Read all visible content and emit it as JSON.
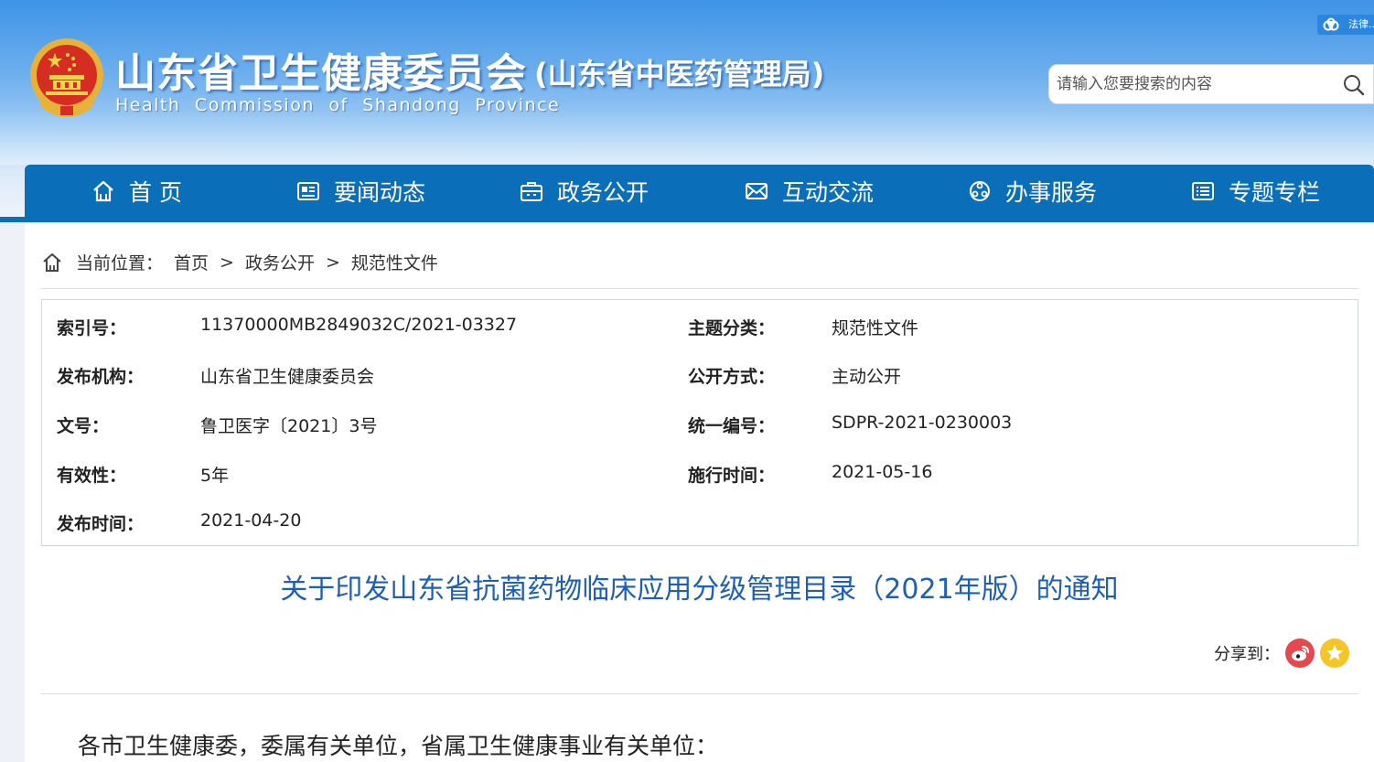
{
  "header": {
    "title": "山东省卫生健康委员会",
    "subtitle": "(山东省中医药管理局)",
    "english_name": "Health Commission of Shandong Province",
    "badge_label": "法律...",
    "search": {
      "placeholder": "请输入您要搜索的内容",
      "value": ""
    }
  },
  "nav": {
    "items": [
      {
        "label": "首 页",
        "icon": "home-icon"
      },
      {
        "label": "要闻动态",
        "icon": "news-icon"
      },
      {
        "label": "政务公开",
        "icon": "briefcase-icon"
      },
      {
        "label": "互动交流",
        "icon": "envelope-icon"
      },
      {
        "label": "办事服务",
        "icon": "service-icon"
      },
      {
        "label": "专题专栏",
        "icon": "column-icon"
      }
    ]
  },
  "breadcrumb": {
    "prefix": "当前位置：",
    "items": [
      "首页",
      "政务公开",
      "规范性文件"
    ],
    "separator": ">"
  },
  "meta": {
    "index_no": {
      "key": "索引号：",
      "value": "11370000MB2849032C/2021-03327"
    },
    "topic": {
      "key": "主题分类：",
      "value": "规范性文件"
    },
    "publisher": {
      "key": "发布机构：",
      "value": "山东省卫生健康委员会"
    },
    "disclosure": {
      "key": "公开方式：",
      "value": "主动公开"
    },
    "doc_no": {
      "key": "文号：",
      "value": "鲁卫医字〔2021〕3号"
    },
    "unified_no": {
      "key": "统一编号：",
      "value": "SDPR-2021-0230003"
    },
    "validity": {
      "key": "有效性：",
      "value": "5年"
    },
    "effective_date": {
      "key": "施行时间：",
      "value": "2021-05-16"
    },
    "publish_date": {
      "key": "发布时间：",
      "value": "2021-04-20"
    }
  },
  "document": {
    "title": "关于印发山东省抗菌药物临床应用分级管理目录（2021年版）的通知",
    "greeting": "各市卫生健康委，委属有关单位，省属卫生健康事业有关单位："
  },
  "share": {
    "label": "分享到：",
    "targets": [
      "weibo-icon",
      "favorite-star-icon"
    ]
  },
  "colors": {
    "nav_bg": "#0a6eb8",
    "title_blue": "#1c5fb4",
    "weibo_red": "#e5484d",
    "star_yellow": "#f3c527"
  }
}
